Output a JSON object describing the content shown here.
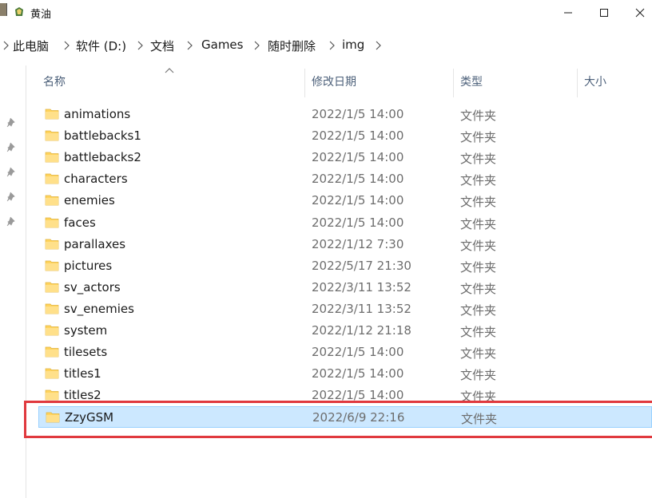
{
  "window": {
    "title": "黄油",
    "controls": {
      "minimize_icon": "minimize-icon",
      "maximize_icon": "maximize-icon",
      "close_icon": "close-icon"
    }
  },
  "breadcrumb": [
    "此电脑",
    "软件 (D:)",
    "文档",
    "Games",
    "随时删除",
    "img"
  ],
  "columns": {
    "name": "名称",
    "date": "修改日期",
    "type": "类型",
    "size": "大小"
  },
  "files": [
    {
      "name": "animations",
      "date": "2022/1/5 14:00",
      "type": "文件夹"
    },
    {
      "name": "battlebacks1",
      "date": "2022/1/5 14:00",
      "type": "文件夹"
    },
    {
      "name": "battlebacks2",
      "date": "2022/1/5 14:00",
      "type": "文件夹"
    },
    {
      "name": "characters",
      "date": "2022/1/5 14:00",
      "type": "文件夹"
    },
    {
      "name": "enemies",
      "date": "2022/1/5 14:00",
      "type": "文件夹"
    },
    {
      "name": "faces",
      "date": "2022/1/5 14:00",
      "type": "文件夹"
    },
    {
      "name": "parallaxes",
      "date": "2022/1/12 7:30",
      "type": "文件夹"
    },
    {
      "name": "pictures",
      "date": "2022/5/17 21:30",
      "type": "文件夹"
    },
    {
      "name": "sv_actors",
      "date": "2022/3/11 13:52",
      "type": "文件夹"
    },
    {
      "name": "sv_enemies",
      "date": "2022/3/11 13:52",
      "type": "文件夹"
    },
    {
      "name": "system",
      "date": "2022/1/12 21:18",
      "type": "文件夹"
    },
    {
      "name": "tilesets",
      "date": "2022/1/5 14:00",
      "type": "文件夹"
    },
    {
      "name": "titles1",
      "date": "2022/1/5 14:00",
      "type": "文件夹"
    },
    {
      "name": "titles2",
      "date": "2022/1/5 14:00",
      "type": "文件夹"
    },
    {
      "name": "ZzyGSM",
      "date": "2022/6/9 22:16",
      "type": "文件夹",
      "selected": true
    }
  ],
  "colors": {
    "selection": "#cce8ff",
    "highlight_box": "#e0393e",
    "folder": "#ffd35c"
  }
}
